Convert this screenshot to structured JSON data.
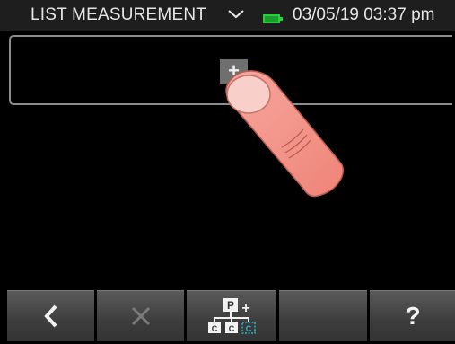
{
  "status_bar": {
    "title": "LIST MEASUREMENT",
    "datetime": "03/05/19 03:37 pm",
    "icons": [
      "chevron-down-icon",
      "battery-icon"
    ],
    "battery_color": "#22d43a"
  },
  "entry": {
    "add_label": "+"
  },
  "softkeys": {
    "back_icon": "chevron-left-icon",
    "delete_icon": "close-icon",
    "hierarchy_icon": "hierarchy-add-icon",
    "hierarchy_icon_text": [
      "P",
      "C",
      "C",
      "C",
      "+"
    ],
    "help_label": "?"
  },
  "colors": {
    "background": "#000000",
    "status_bar": "#1e1e1e",
    "softkey": "#4a4a4a",
    "disabled_icon": "#7a7a7a",
    "accent_cyan": "#2bb3c4"
  }
}
